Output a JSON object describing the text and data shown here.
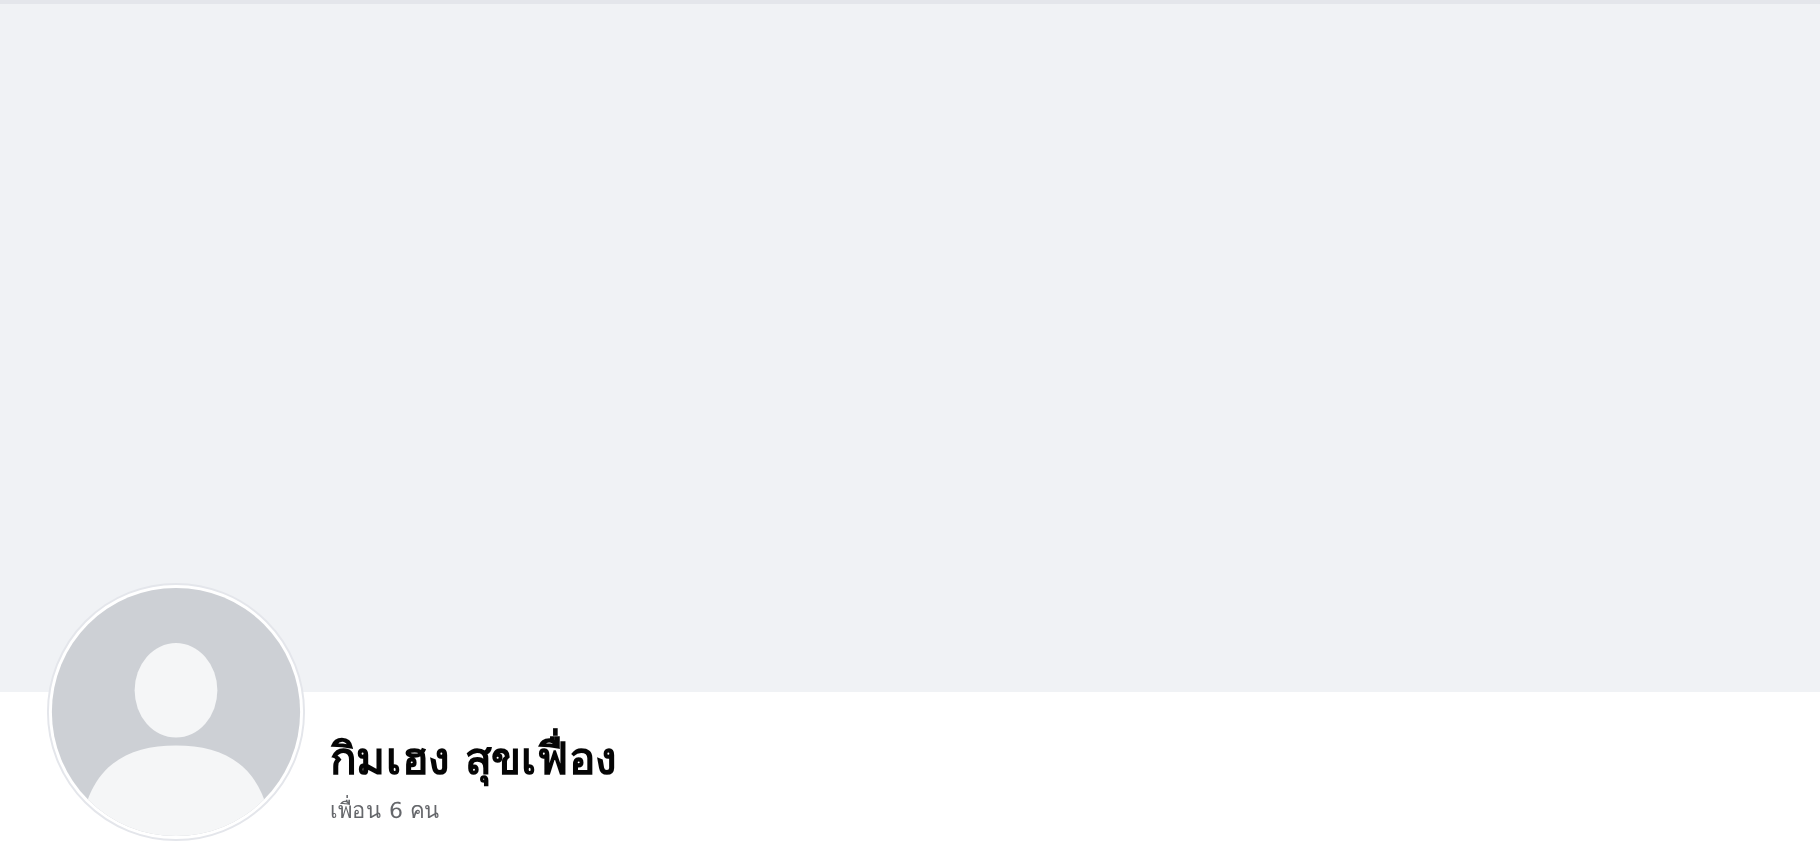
{
  "profile": {
    "name": "กิมเฮง สุขเฟื่อง",
    "friends": "เพื่อน 6 คน"
  }
}
